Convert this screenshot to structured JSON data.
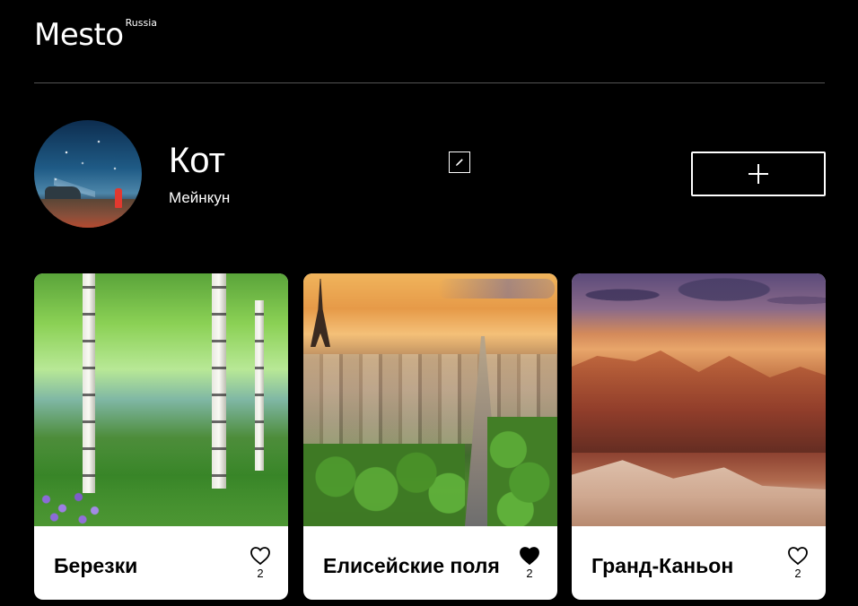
{
  "header": {
    "logo_text": "Mesto",
    "logo_sup": "Russia"
  },
  "profile": {
    "name": "Кот",
    "about": "Мейнкун",
    "edit_icon": "pencil-icon",
    "add_icon": "plus-icon"
  },
  "cards": [
    {
      "title": "Березки",
      "likes": "2",
      "liked": false,
      "image": "birch-forest"
    },
    {
      "title": "Елисейские поля",
      "likes": "2",
      "liked": true,
      "image": "paris-avenue"
    },
    {
      "title": "Гранд-Каньон",
      "likes": "2",
      "liked": false,
      "image": "grand-canyon"
    }
  ],
  "colors": {
    "background": "#000000",
    "card": "#ffffff",
    "divider": "#545454"
  }
}
